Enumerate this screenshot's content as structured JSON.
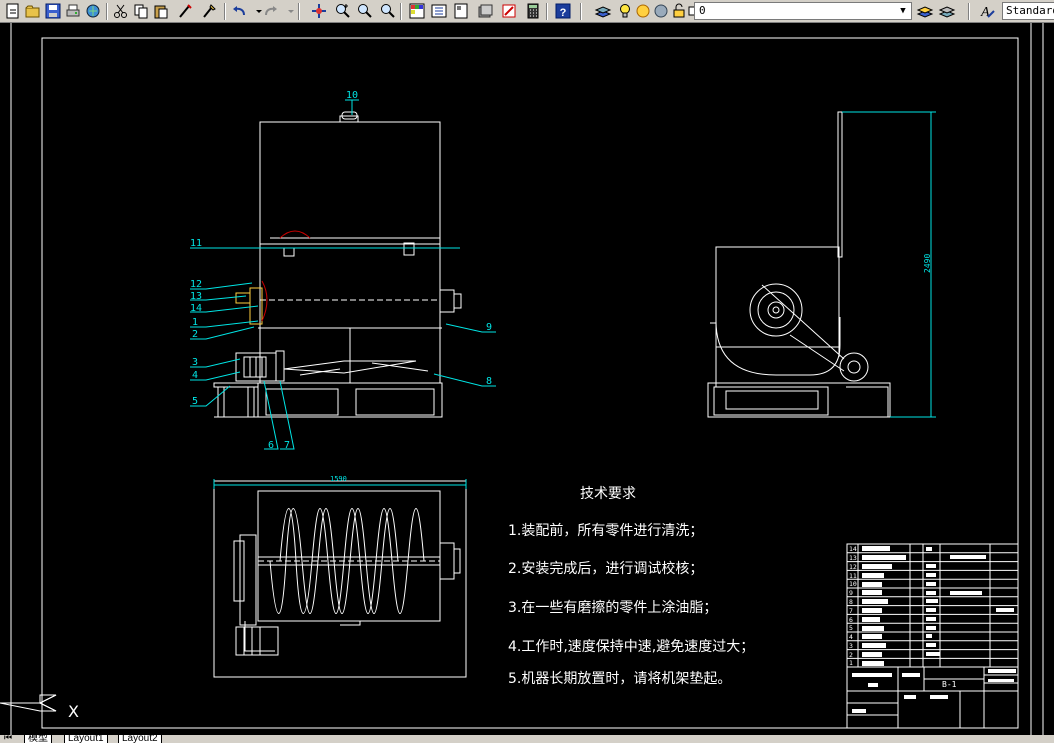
{
  "toolbar": {
    "icons": [
      "new-icon",
      "open-icon",
      "save-icon",
      "plot-icon",
      "cut-icon",
      "copy-icon",
      "paste-icon",
      "match-properties-icon",
      "brush-icon",
      "undo-icon",
      "redo-icon",
      "pan-icon",
      "zoom-realtime-icon",
      "zoom-window-icon",
      "zoom-previous-icon",
      "properties-icon",
      "design-center-icon",
      "tool-palette-icon",
      "sheet-set-icon",
      "markup-icon",
      "calculator-icon",
      "help-icon",
      "layer-manager-icon"
    ],
    "layer_value": "0",
    "text_style_value": "Standard"
  },
  "drawing": {
    "part_numbers": [
      "10",
      "11",
      "12",
      "13",
      "14",
      "1",
      "2",
      "3",
      "4",
      "5",
      "6",
      "7",
      "8",
      "9"
    ],
    "dim_side_height": "2490",
    "dim_plan_width": "1590",
    "tech_requirements": {
      "title": "技术要求",
      "items": [
        "1.装配前，所有零件进行清洗；",
        "2.安装完成后，进行调试校核；",
        "3.在一些有磨擦的零件上涂油脂；",
        "4.工作时,速度保持中速,避免速度过大；",
        "5.机器长期放置时，请将机架垫起。"
      ]
    },
    "title_block": {
      "row_numbers": [
        "14",
        "13",
        "12",
        "11",
        "10",
        "9",
        "8",
        "7",
        "6",
        "5",
        "4",
        "3",
        "2",
        "1"
      ],
      "drawing_code": "B-1",
      "ucs_label": "X"
    }
  },
  "tabs": {
    "model": "模型",
    "layout1": "Layout1",
    "layout2": "Layout2"
  }
}
